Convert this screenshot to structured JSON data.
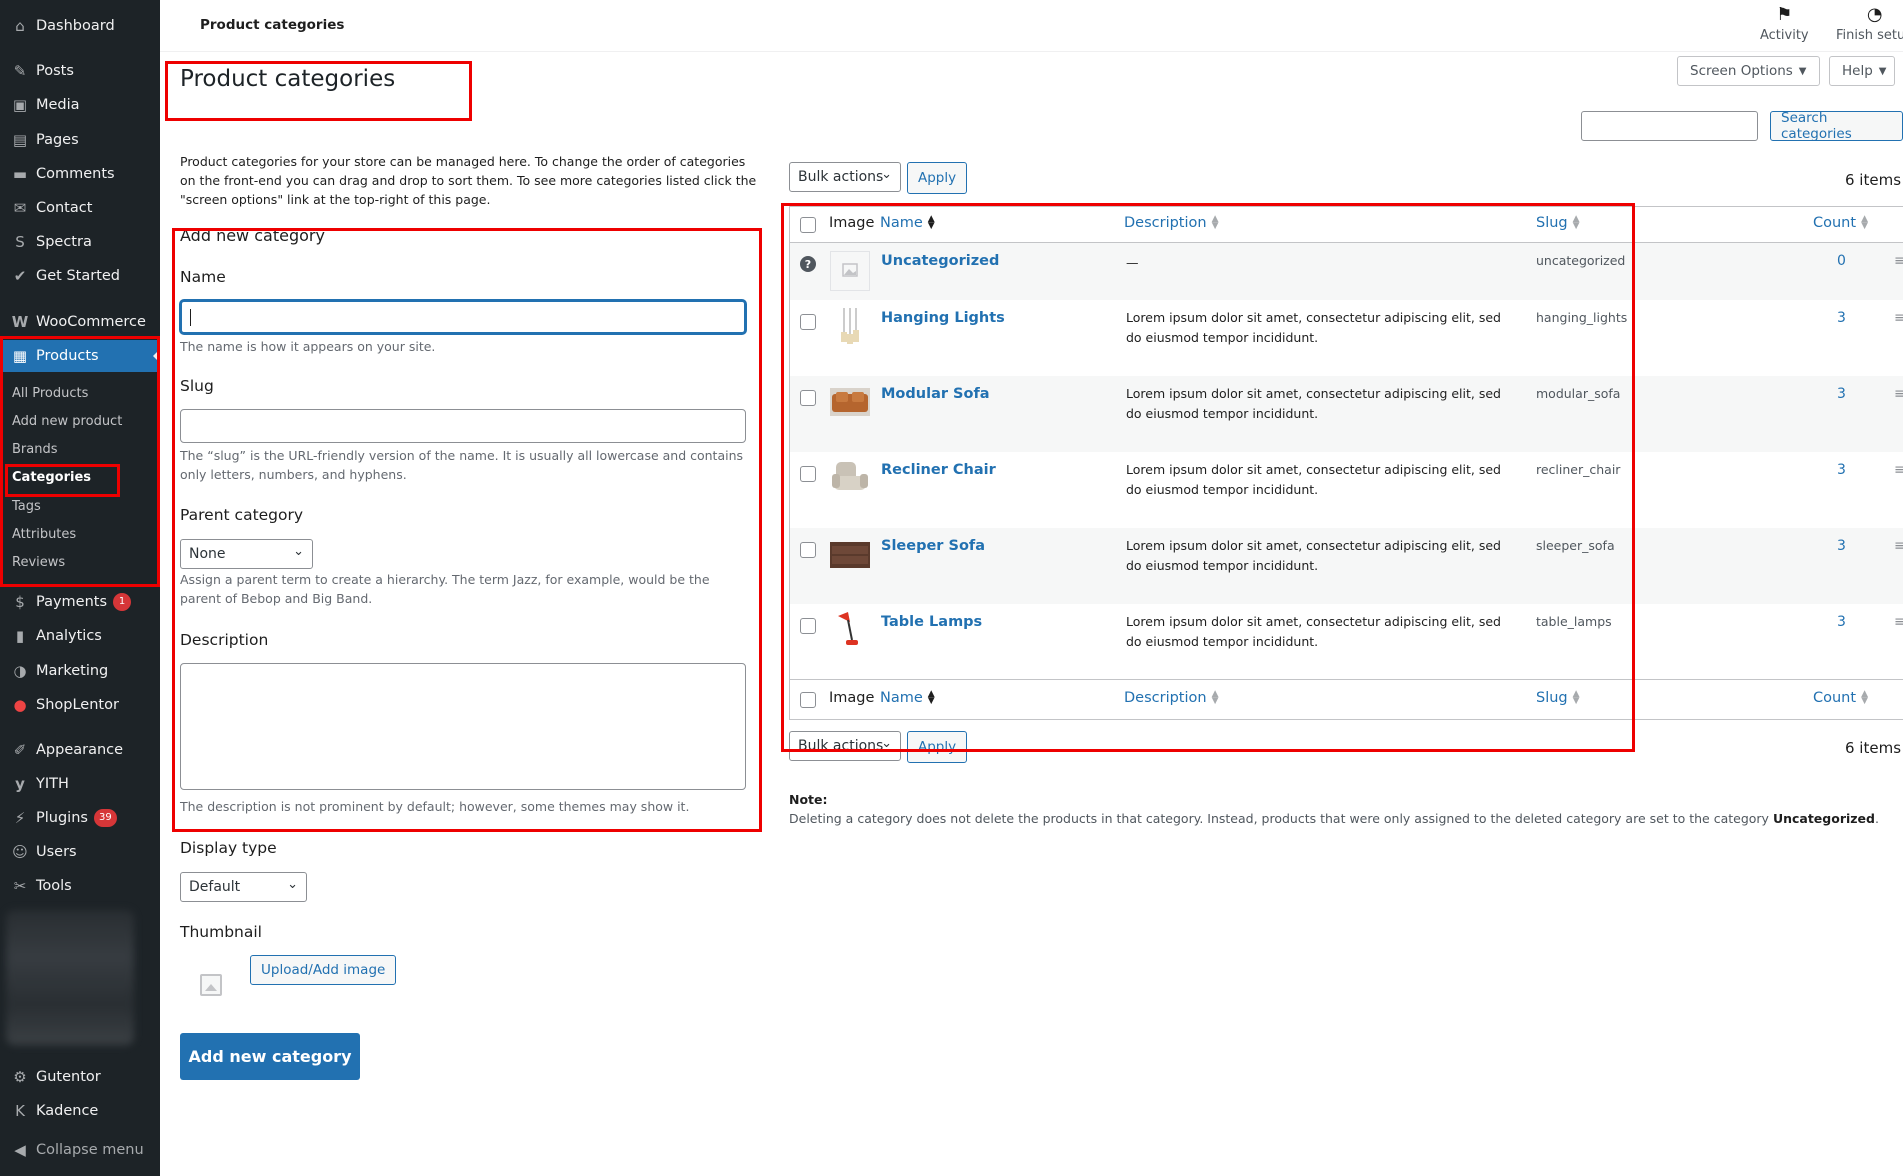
{
  "sidebar": {
    "groups": [
      [
        {
          "label": "Dashboard",
          "icon": "dashboard-icon",
          "glyph": "⌂"
        }
      ],
      [
        {
          "label": "Posts",
          "icon": "pin-icon",
          "glyph": "✎"
        },
        {
          "label": "Media",
          "icon": "media-icon",
          "glyph": "▣"
        },
        {
          "label": "Pages",
          "icon": "pages-icon",
          "glyph": "▤"
        },
        {
          "label": "Comments",
          "icon": "comments-icon",
          "glyph": "▬"
        },
        {
          "label": "Contact",
          "icon": "mail-icon",
          "glyph": "✉"
        },
        {
          "label": "Spectra",
          "icon": "spectra-icon",
          "glyph": "S"
        },
        {
          "label": "Get Started",
          "icon": "checkmark-icon",
          "glyph": "✔"
        }
      ],
      [
        {
          "label": "WooCommerce",
          "icon": "woocommerce-icon",
          "glyph": "W"
        },
        {
          "label": "Products",
          "icon": "products-icon",
          "glyph": "▦"
        }
      ]
    ],
    "product_submenu": [
      "All Products",
      "Add new product",
      "Brands",
      "Categories",
      "Tags",
      "Attributes",
      "Reviews"
    ],
    "after_products": [
      {
        "label": "Payments",
        "icon": "payments-icon",
        "glyph": "$",
        "badge": "1"
      },
      {
        "label": "Analytics",
        "icon": "analytics-icon",
        "glyph": "▮"
      },
      {
        "label": "Marketing",
        "icon": "marketing-icon",
        "glyph": "◑"
      },
      {
        "label": "ShopLentor",
        "icon": "shoplentor-icon",
        "glyph": "●"
      },
      {
        "label": "Appearance",
        "icon": "brush-icon",
        "glyph": "✐"
      },
      {
        "label": "YITH",
        "icon": "yith-icon",
        "glyph": "y"
      },
      {
        "label": "Plugins",
        "icon": "plugins-icon",
        "glyph": "⚡",
        "badge": "39"
      },
      {
        "label": "Users",
        "icon": "users-icon",
        "glyph": "☺"
      },
      {
        "label": "Tools",
        "icon": "tools-icon",
        "glyph": "✂"
      }
    ],
    "bottom": [
      {
        "label": "Gutentor",
        "icon": "gutentor-icon",
        "glyph": "⚙"
      },
      {
        "label": "Kadence",
        "icon": "kadence-icon",
        "glyph": "K"
      },
      {
        "label": "Collapse menu",
        "icon": "collapse-icon",
        "glyph": "◀"
      }
    ]
  },
  "topbar": {
    "breadcrumb": "Product categories",
    "activity": "Activity",
    "finish_setup": "Finish setup",
    "screen_options": "Screen Options",
    "help": "Help"
  },
  "page": {
    "title": "Product categories",
    "intro": "Product categories for your store can be managed here. To change the order of categories on the front-end you can drag and drop to sort them. To see more categories listed click the \"screen options\" link at the top-right of this page."
  },
  "form": {
    "heading": "Add new category",
    "name_label": "Name",
    "name_help": "The name is how it appears on your site.",
    "slug_label": "Slug",
    "slug_help": "The “slug” is the URL-friendly version of the name. It is usually all lowercase and contains only letters, numbers, and hyphens.",
    "parent_label": "Parent category",
    "parent_value": "None",
    "parent_help": "Assign a parent term to create a hierarchy. The term Jazz, for example, would be the parent of Bebop and Big Band.",
    "description_label": "Description",
    "description_help": "The description is not prominent by default; however, some themes may show it.",
    "display_type_label": "Display type",
    "display_type_value": "Default",
    "thumbnail_label": "Thumbnail",
    "upload_button": "Upload/Add image",
    "submit_button": "Add new category"
  },
  "list": {
    "search_button": "Search categories",
    "bulk_actions": "Bulk actions",
    "apply": "Apply",
    "items_count": "6 items",
    "columns": {
      "image": "Image",
      "name": "Name",
      "description": "Description",
      "slug": "Slug",
      "count": "Count"
    },
    "rows": [
      {
        "name": "Uncategorized",
        "description": "—",
        "slug": "uncategorized",
        "count": "0",
        "image": "placeholder"
      },
      {
        "name": "Hanging Lights",
        "description": "Lorem ipsum dolor sit amet, consectetur adipiscing elit, sed do eiusmod tempor incididunt.",
        "slug": "hanging_lights",
        "count": "3",
        "image": "hanging-lights"
      },
      {
        "name": "Modular Sofa",
        "description": "Lorem ipsum dolor sit amet, consectetur adipiscing elit, sed do eiusmod tempor incididunt.",
        "slug": "modular_sofa",
        "count": "3",
        "image": "modular-sofa"
      },
      {
        "name": "Recliner Chair",
        "description": "Lorem ipsum dolor sit amet, consectetur adipiscing elit, sed do eiusmod tempor incididunt.",
        "slug": "recliner_chair",
        "count": "3",
        "image": "recliner-chair"
      },
      {
        "name": "Sleeper Sofa",
        "description": "Lorem ipsum dolor sit amet, consectetur adipiscing elit, sed do eiusmod tempor incididunt.",
        "slug": "sleeper_sofa",
        "count": "3",
        "image": "sleeper-sofa"
      },
      {
        "name": "Table Lamps",
        "description": "Lorem ipsum dolor sit amet, consectetur adipiscing elit, sed do eiusmod tempor incididunt.",
        "slug": "table_lamps",
        "count": "3",
        "image": "table-lamps"
      }
    ],
    "note_label": "Note:",
    "note_text": "Deleting a category does not delete the products in that category. Instead, products that were only assigned to the deleted category are set to the category",
    "note_strong": "Uncategorized",
    "note_end": "."
  },
  "colors": {
    "accent": "#2271b1",
    "sidebar_bg": "#1d2327",
    "highlight": "#e00000",
    "badge": "#d63638"
  }
}
